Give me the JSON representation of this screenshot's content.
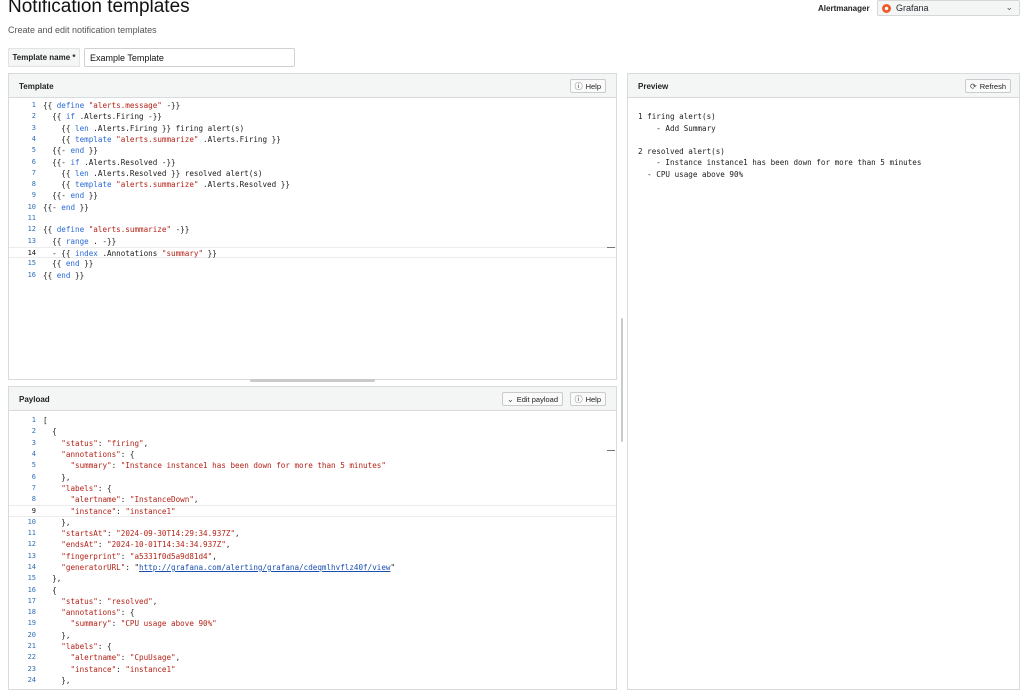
{
  "header": {
    "title": "Notification templates",
    "subtitle": "Create and edit notification templates",
    "alertmanager_label": "Alertmanager",
    "alertmanager_value": "Grafana"
  },
  "form": {
    "template_name_label": "Template name *",
    "template_name_value": "Example Template"
  },
  "template_panel": {
    "title": "Template",
    "help_label": "Help",
    "active_line": 14,
    "lines": [
      "{{ define \"alerts.message\" -}}",
      "  {{ if .Alerts.Firing -}}",
      "    {{ len .Alerts.Firing }} firing alert(s)",
      "    {{ template \"alerts.summarize\" .Alerts.Firing }}",
      "  {{- end }}",
      "  {{- if .Alerts.Resolved -}}",
      "    {{ len .Alerts.Resolved }} resolved alert(s)",
      "    {{ template \"alerts.summarize\" .Alerts.Resolved }}",
      "  {{- end }}",
      "{{- end }}",
      "",
      "{{ define \"alerts.summarize\" -}}",
      "  {{ range . -}}",
      "  - {{ index .Annotations \"summary\" }}",
      "  {{ end }}",
      "{{ end }}"
    ]
  },
  "payload_panel": {
    "title": "Payload",
    "edit_label": "Edit payload",
    "help_label": "Help",
    "active_line": 9,
    "lines": [
      "[",
      "  {",
      "    \"status\": \"firing\",",
      "    \"annotations\": {",
      "      \"summary\": \"Instance instance1 has been down for more than 5 minutes\"",
      "    },",
      "    \"labels\": {",
      "      \"alertname\": \"InstanceDown\",",
      "      \"instance\": \"instance1\"",
      "    },",
      "    \"startsAt\": \"2024-09-30T14:29:34.937Z\",",
      "    \"endsAt\": \"2024-10-01T14:34:34.937Z\",",
      "    \"fingerprint\": \"a5331f0d5a9d81d4\",",
      "    \"generatorURL\": \"http://grafana.com/alerting/grafana/cdeqmlhvflz40f/view\"",
      "  },",
      "  {",
      "    \"status\": \"resolved\",",
      "    \"annotations\": {",
      "      \"summary\": \"CPU usage above 90%\"",
      "    },",
      "    \"labels\": {",
      "      \"alertname\": \"CpuUsage\",",
      "      \"instance\": \"instance1\"",
      "    },"
    ]
  },
  "preview_panel": {
    "title": "Preview",
    "refresh_label": "Refresh",
    "lines": [
      "1 firing alert(s)",
      "    - Add Summary",
      "",
      "2 resolved alert(s)",
      "    - Instance instance1 has been down for more than 5 minutes",
      "  - CPU usage above 90%"
    ]
  },
  "icons": {
    "help": "help-circle-icon",
    "refresh": "sync-icon",
    "edit_payload": "chevron-down-icon",
    "alertmanager_logo": "grafana-logo-icon"
  },
  "colors": {
    "keyword": "#2a6ad6",
    "string": "#b42318",
    "line_number": "#2f6fb5",
    "panel_header": "#f4f5f5"
  }
}
